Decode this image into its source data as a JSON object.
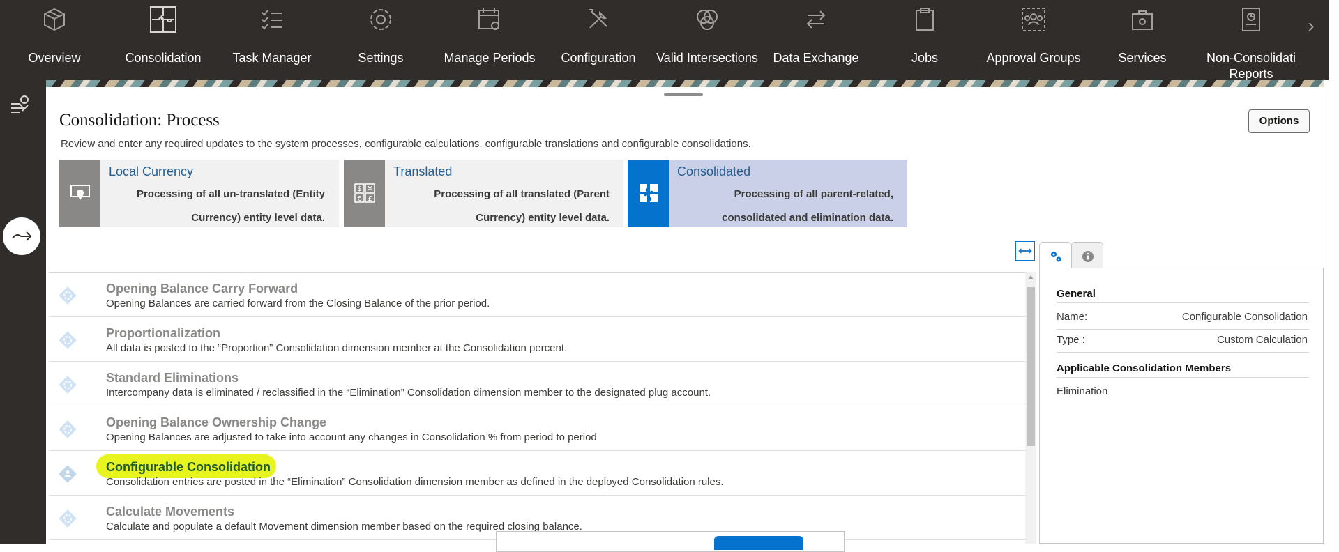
{
  "nav": {
    "items": [
      {
        "label": "Overview",
        "icon": "cube-icon"
      },
      {
        "label": "Consolidation",
        "icon": "puzzle-icon"
      },
      {
        "label": "Task Manager",
        "icon": "checklist-icon"
      },
      {
        "label": "Settings",
        "icon": "gear-icon"
      },
      {
        "label": "Manage Periods",
        "icon": "calendar-gear-icon"
      },
      {
        "label": "Configuration",
        "icon": "tools-icon"
      },
      {
        "label": "Valid Intersections",
        "icon": "venn-icon"
      },
      {
        "label": "Data Exchange",
        "icon": "exchange-arrows-icon"
      },
      {
        "label": "Jobs",
        "icon": "clipboard-icon"
      },
      {
        "label": "Approval Groups",
        "icon": "group-icon"
      },
      {
        "label": "Services",
        "icon": "toolbox-icon"
      },
      {
        "label": "Non-Consolidati Reports",
        "icon": "report-icon"
      }
    ],
    "more_glyph": "›"
  },
  "page": {
    "title": "Consolidation: Process",
    "description": "Review and enter any required updates to the system processes, configurable calculations, configurable translations and configurable consolidations.",
    "options_label": "Options"
  },
  "cards": [
    {
      "title": "Local Currency",
      "text": "Processing of all un-translated (Entity Currency) entity level data.",
      "icon": "location-pin-icon",
      "active": false
    },
    {
      "title": "Translated",
      "text": "Processing of all translated (Parent Currency) entity level data.",
      "icon": "currency-icon",
      "active": false
    },
    {
      "title": "Consolidated",
      "text": "Processing of all parent-related, consolidated and elimination data.",
      "icon": "consolidate-icon",
      "active": true
    }
  ],
  "rules": [
    {
      "title": "Opening Balance Carry Forward",
      "desc": "Opening Balances are carried forward from the Closing Balance of the prior period."
    },
    {
      "title": "Proportionalization",
      "desc": "All data is posted to the “Proportion” Consolidation dimension member at the Consolidation percent."
    },
    {
      "title": "Standard Eliminations",
      "desc": "Intercompany data is eliminated / reclassified in the “Elimination” Consolidation dimension member to the designated plug account."
    },
    {
      "title": "Opening Balance Ownership Change",
      "desc": "Opening Balances are adjusted to take into account any changes in Consolidation % from period to period"
    },
    {
      "title": "Configurable Consolidation",
      "desc": "Consolidation entries are posted in the “Elimination” Consolidation dimension member as defined in the deployed Consolidation rules."
    },
    {
      "title": "Calculate Movements",
      "desc": "Calculate and populate a default Movement dimension member based on the required closing balance."
    }
  ],
  "selected_rule_index": 4,
  "props": {
    "general_heading": "General",
    "name_label": "Name:",
    "name_value": "Configurable Consolidation",
    "type_label": "Type  :",
    "type_value": "Custom Calculation",
    "members_heading": "Applicable Consolidation Members",
    "members": [
      "Elimination"
    ]
  },
  "colors": {
    "topbar": "#312d2a",
    "accent": "#0572ce",
    "link": "#245f91",
    "selected_row": "#dcecfb",
    "highlight": "#e8f41f"
  }
}
